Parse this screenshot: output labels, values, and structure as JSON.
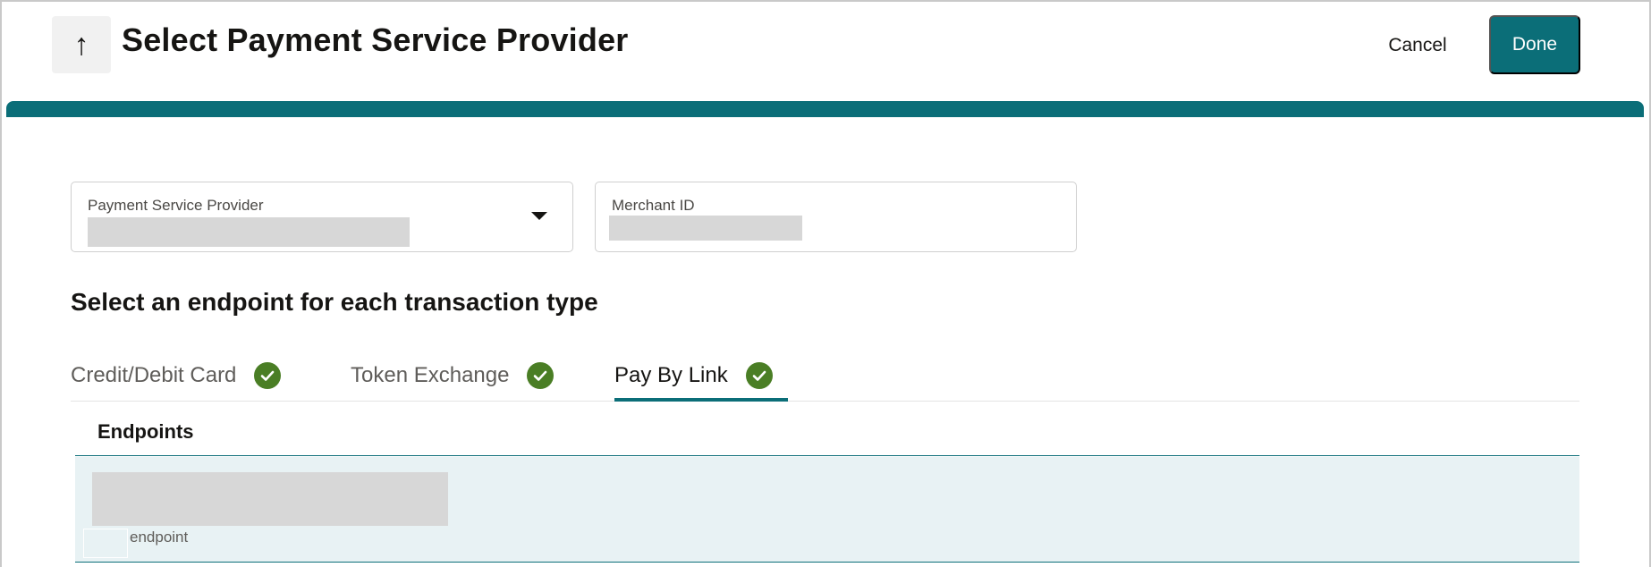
{
  "header": {
    "back_icon_glyph": "↑",
    "title": "Select Payment Service Provider",
    "cancel_label": "Cancel",
    "done_label": "Done"
  },
  "form": {
    "psp_label": "Payment Service Provider",
    "merchant_label": "Merchant ID"
  },
  "section": {
    "title": "Select an endpoint for each transaction type"
  },
  "tabs": [
    {
      "label": "Credit/Debit Card",
      "complete": true,
      "selected": false
    },
    {
      "label": "Token Exchange",
      "complete": true,
      "selected": false
    },
    {
      "label": "Pay By Link",
      "complete": true,
      "selected": true
    }
  ],
  "table": {
    "column_header": "Endpoints",
    "rows": [
      {
        "subtext": "endpoint"
      }
    ]
  },
  "colors": {
    "accent": "#0b6e78",
    "success": "#4a7e25",
    "row_selected": "#e8f2f4"
  }
}
